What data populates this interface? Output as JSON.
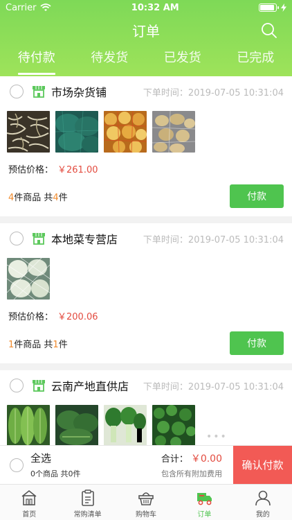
{
  "status_bar": {
    "carrier": "Carrier",
    "time": "10:32 AM"
  },
  "header": {
    "title": "订单",
    "tabs": [
      {
        "label": "待付款",
        "active": true
      },
      {
        "label": "待发货",
        "active": false
      },
      {
        "label": "已发货",
        "active": false
      },
      {
        "label": "已完成",
        "active": false
      }
    ]
  },
  "orders": [
    {
      "shop_name": "市场杂货铺",
      "order_time": "下单时间：2019-07-05 10:31:04",
      "price_label": "预估价格：",
      "price_value": "￥261.00",
      "item_kinds": "4",
      "kinds_suffix": "件商品 共",
      "item_total": "4",
      "total_suffix": "件",
      "pay_label": "付款",
      "thumbs": [
        "bean-sprouts",
        "green-sack",
        "onion-sack",
        "potato-bag"
      ]
    },
    {
      "shop_name": "本地菜专营店",
      "order_time": "下单时间：2019-07-05 10:31:04",
      "price_label": "预估价格：",
      "price_value": "￥200.06",
      "item_kinds": "1",
      "kinds_suffix": "件商品 共",
      "item_total": "1",
      "total_suffix": "件",
      "pay_label": "付款",
      "thumbs": [
        "melon-net"
      ]
    },
    {
      "shop_name": "云南产地直供店",
      "order_time": "下单时间：2019-07-05 10:31:04",
      "thumbs": [
        "lettuce",
        "pak-choi",
        "bok-choy",
        "spinach"
      ]
    }
  ],
  "bottom_bar": {
    "select_all": "全选",
    "selected_count": "0个商品 共0件",
    "total_label": "合计：",
    "total_value": "￥0.00",
    "total_note": "包含所有附加费用",
    "confirm_label": "确认付款"
  },
  "tabbar": [
    {
      "label": "首页",
      "icon": "home-icon",
      "active": false
    },
    {
      "label": "常购清单",
      "icon": "list-icon",
      "active": false
    },
    {
      "label": "购物车",
      "icon": "basket-icon",
      "active": false
    },
    {
      "label": "订单",
      "icon": "truck-icon",
      "active": true
    },
    {
      "label": "我的",
      "icon": "user-icon",
      "active": false
    }
  ],
  "colors": {
    "brand": "#7ed957",
    "accent_green": "#4fc44f",
    "price_red": "#e34b3f",
    "confirm_red": "#f25a55",
    "count_orange": "#f08a2c"
  }
}
